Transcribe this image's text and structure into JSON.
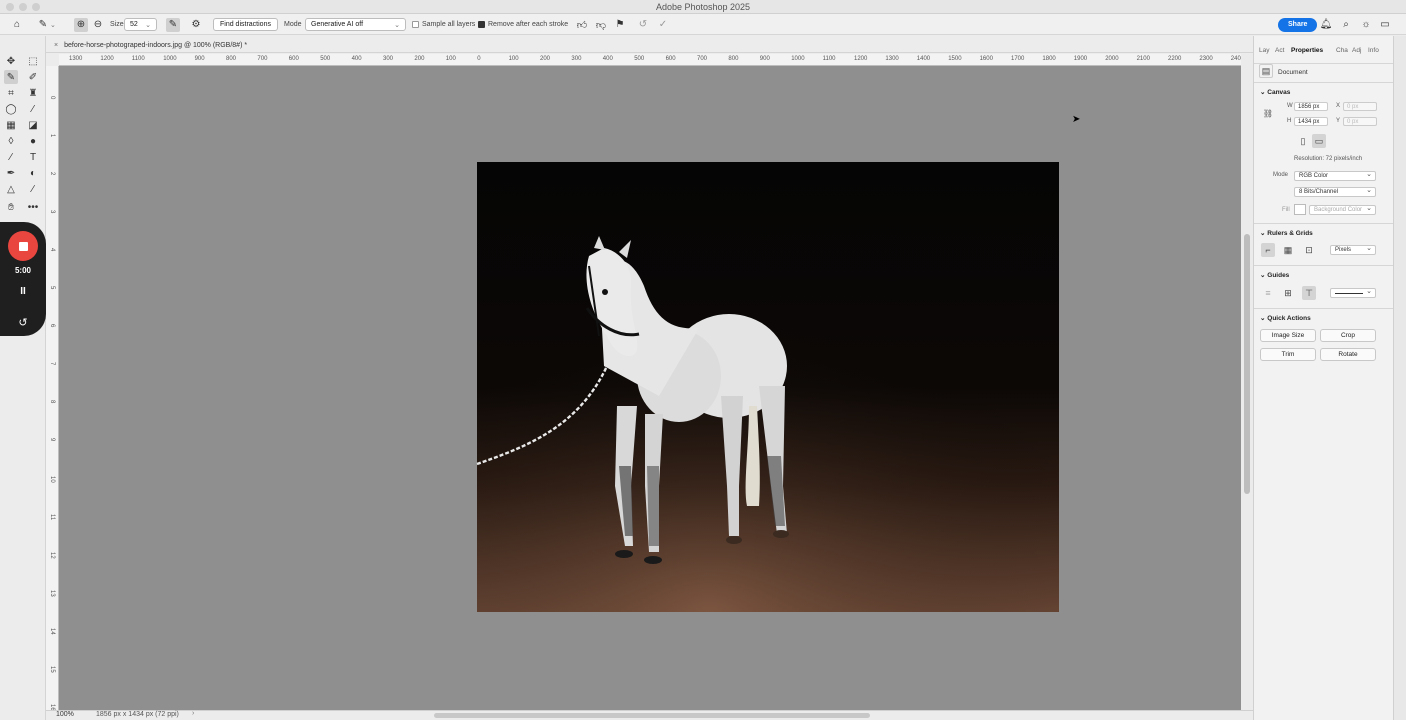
{
  "window": {
    "title": "Adobe Photoshop 2025"
  },
  "options_bar": {
    "size_label": "Size",
    "size_value": "52",
    "find_distractions_label": "Find distractions",
    "mode_label": "Mode",
    "mode_value": "Generative AI off",
    "sample_all_layers_label": "Sample all layers",
    "remove_after_stroke_label": "Remove after each stroke",
    "share_label": "Share"
  },
  "document_tab": {
    "close": "×",
    "title": "before-horse-photograped-indoors.jpg @ 100% (RGB/8#) *"
  },
  "ruler_top_labels": [
    "1300",
    "1200",
    "1100",
    "1000",
    "900",
    "800",
    "700",
    "600",
    "500",
    "400",
    "300",
    "200",
    "100",
    "0",
    "100",
    "200",
    "300",
    "400",
    "500",
    "600",
    "700",
    "800",
    "900",
    "1000",
    "1100",
    "1200",
    "1300",
    "1400",
    "1500",
    "1600",
    "1700",
    "1800",
    "1900",
    "2000",
    "2100",
    "2200",
    "2300",
    "240"
  ],
  "ruler_left_labels": [
    "0",
    "1",
    "2",
    "3",
    "4",
    "5",
    "6",
    "7",
    "8",
    "9",
    "10",
    "11",
    "12",
    "13",
    "14",
    "15",
    "16"
  ],
  "recorder": {
    "time": "5:00",
    "pause": "II",
    "undo": "↺"
  },
  "panel": {
    "tabs": {
      "layers": "Lay",
      "actions": "Act",
      "properties": "Properties",
      "channels": "Cha",
      "adjustments": "Adj",
      "info": "Info"
    },
    "document_label": "Document",
    "canvas_header": "Canvas",
    "w_label": "W",
    "w_value": "1856 px",
    "h_label": "H",
    "h_value": "1434 px",
    "x_label": "X",
    "x_value": "0 px",
    "y_label": "Y",
    "y_value": "0 px",
    "resolution": "Resolution: 72 pixels/inch",
    "mode_label": "Mode",
    "mode_value": "RGB Color",
    "bits_value": "8 Bits/Channel",
    "fill_label": "Fill",
    "fill_value": "Background Color",
    "rulers_header": "Rulers & Grids",
    "units_value": "Pixels",
    "guides_header": "Guides",
    "quick_actions_header": "Quick Actions",
    "btn_image_size": "Image Size",
    "btn_crop": "Crop",
    "btn_trim": "Trim",
    "btn_rotate": "Rotate"
  },
  "status_bar": {
    "zoom": "100%",
    "dims": "1856 px x 1434 px (72 ppi)"
  }
}
